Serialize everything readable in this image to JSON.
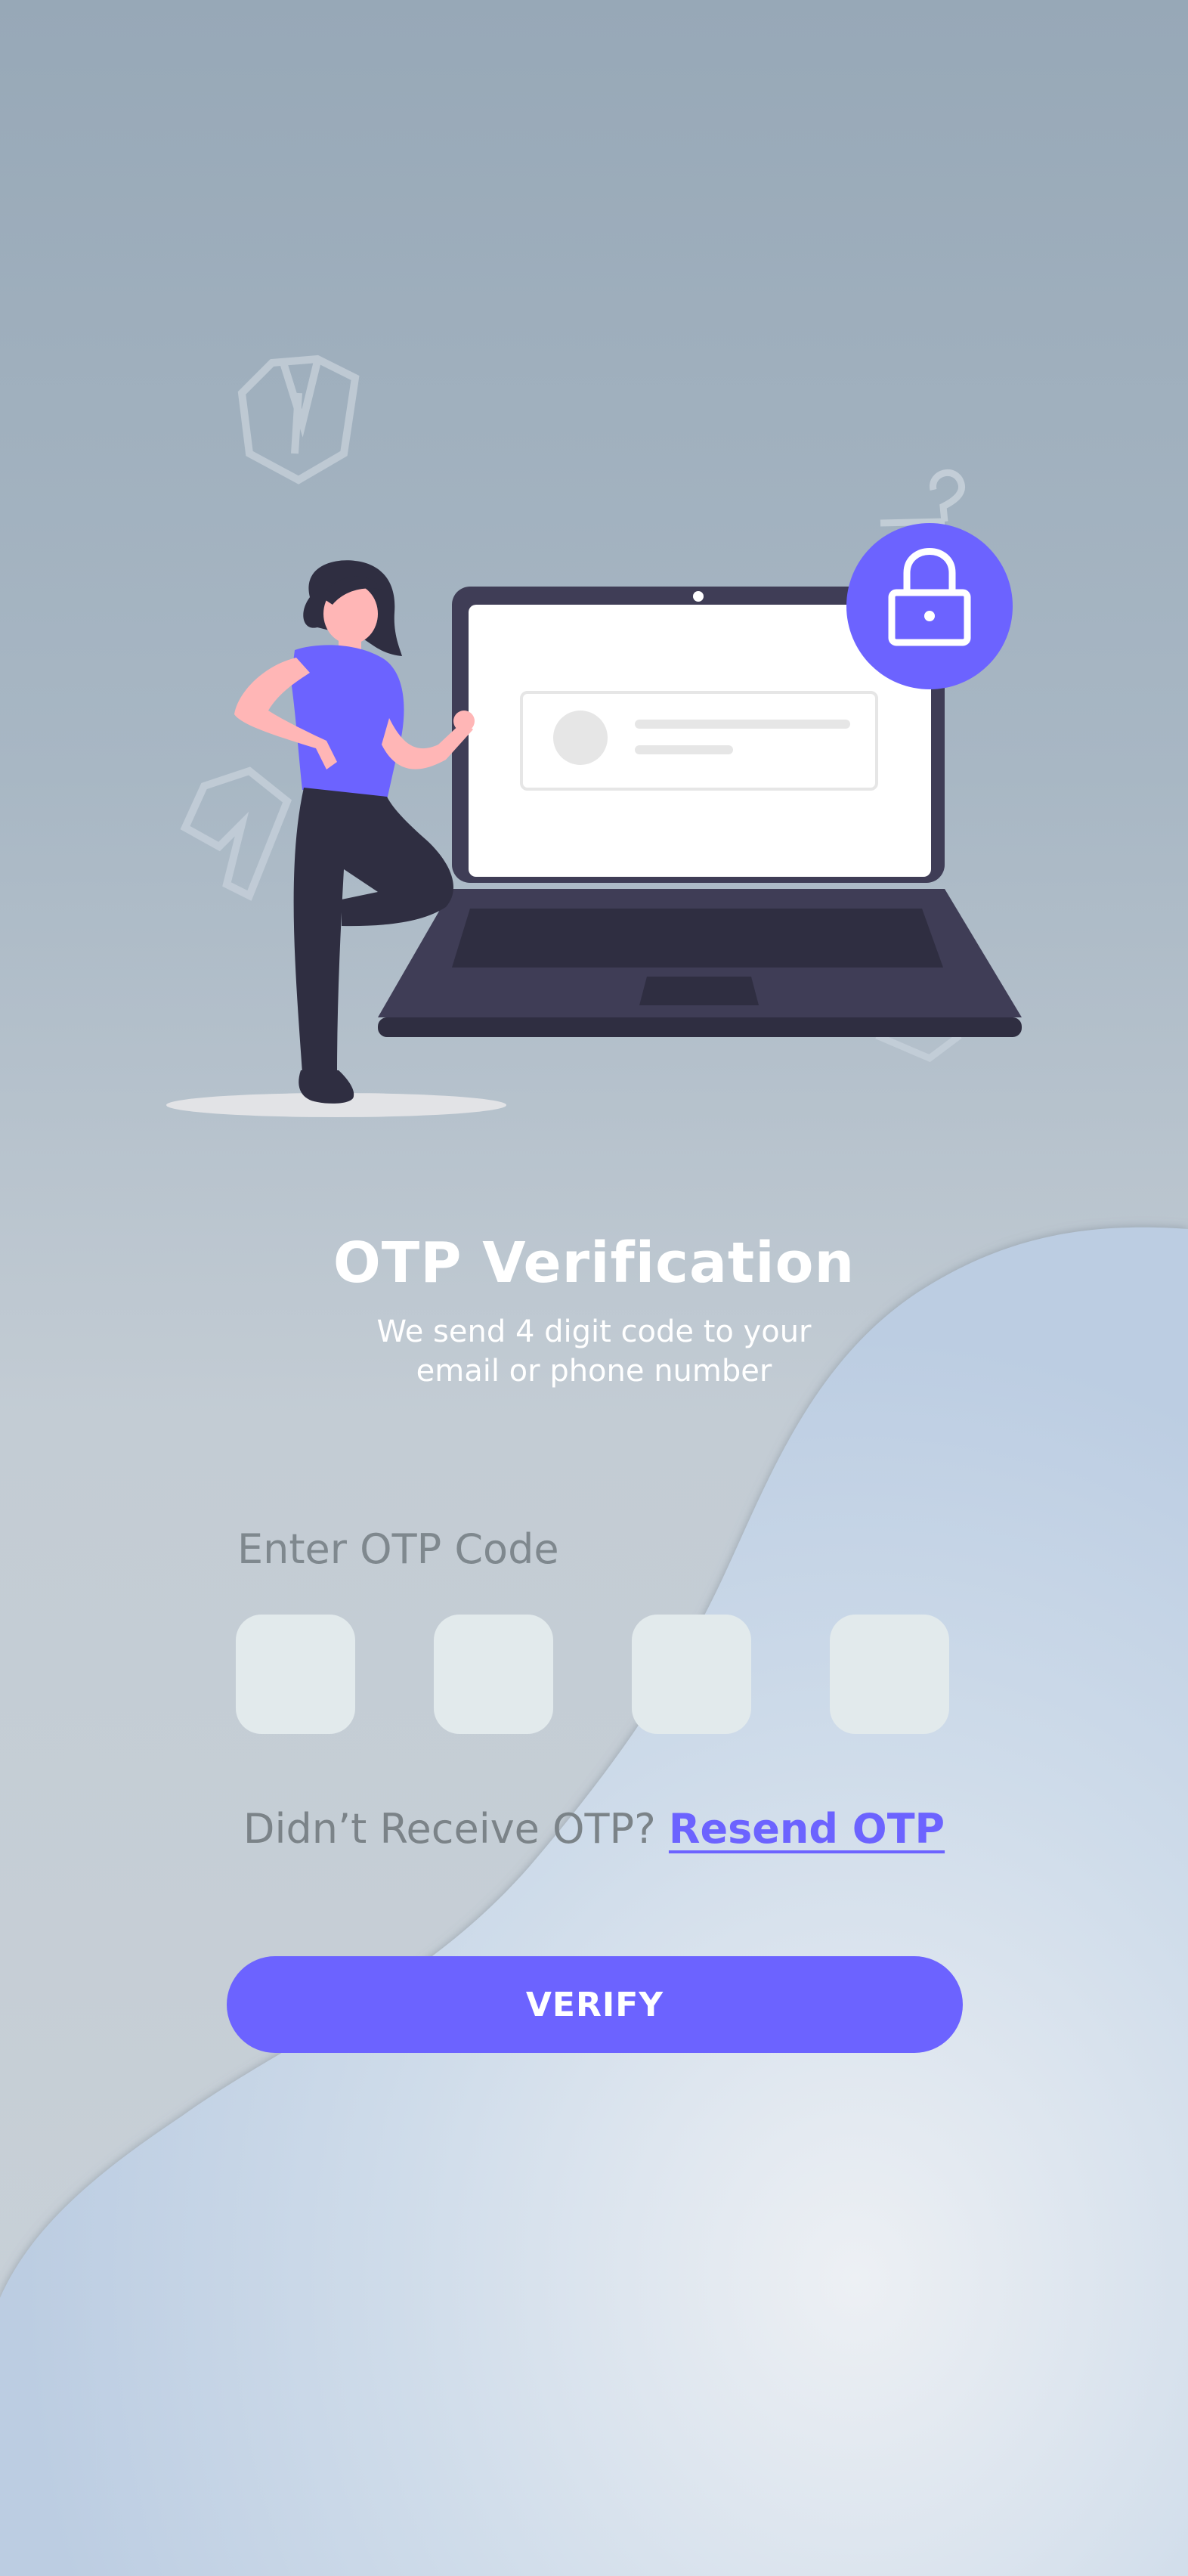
{
  "header": {
    "title": "OTP Verification",
    "subtitle_line1": "We send 4 digit code to your",
    "subtitle_line2": "email or phone number"
  },
  "otp": {
    "label": "Enter OTP Code",
    "digits": [
      "",
      "",
      "",
      ""
    ]
  },
  "resend": {
    "prompt": "Didn’t Receive OTP?",
    "link_label": "Resend OTP"
  },
  "actions": {
    "verify_label": "VERIFY"
  },
  "colors": {
    "accent": "#6c63ff",
    "laptop": "#3f3d56",
    "otp_box": "#e2eaec",
    "skin": "#ffb6b6"
  },
  "icons": {
    "lock": "lock-icon",
    "laptop": "laptop-illustration",
    "person": "person-illustration"
  }
}
